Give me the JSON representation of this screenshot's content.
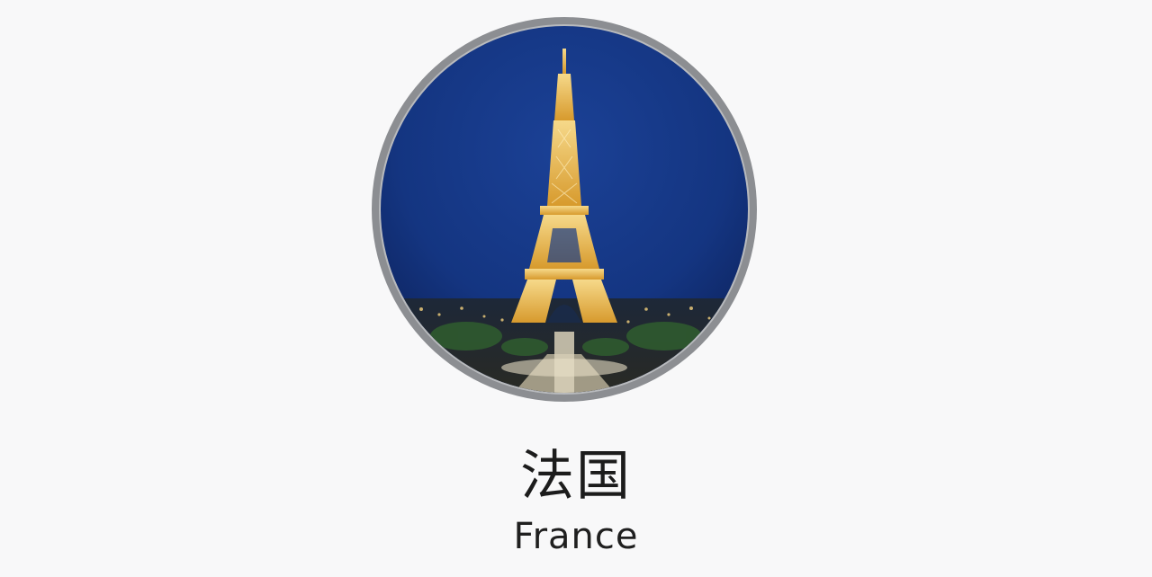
{
  "country": {
    "name_cn": "法国",
    "name_en": "France",
    "image_icon": "eiffel-tower-night-photo"
  },
  "colors": {
    "ring": "#8c8e92",
    "sky_top": "#0f2458",
    "sky_mid": "#173a86",
    "tower_light": "#f2c35a",
    "background": "#f8f8f9"
  }
}
